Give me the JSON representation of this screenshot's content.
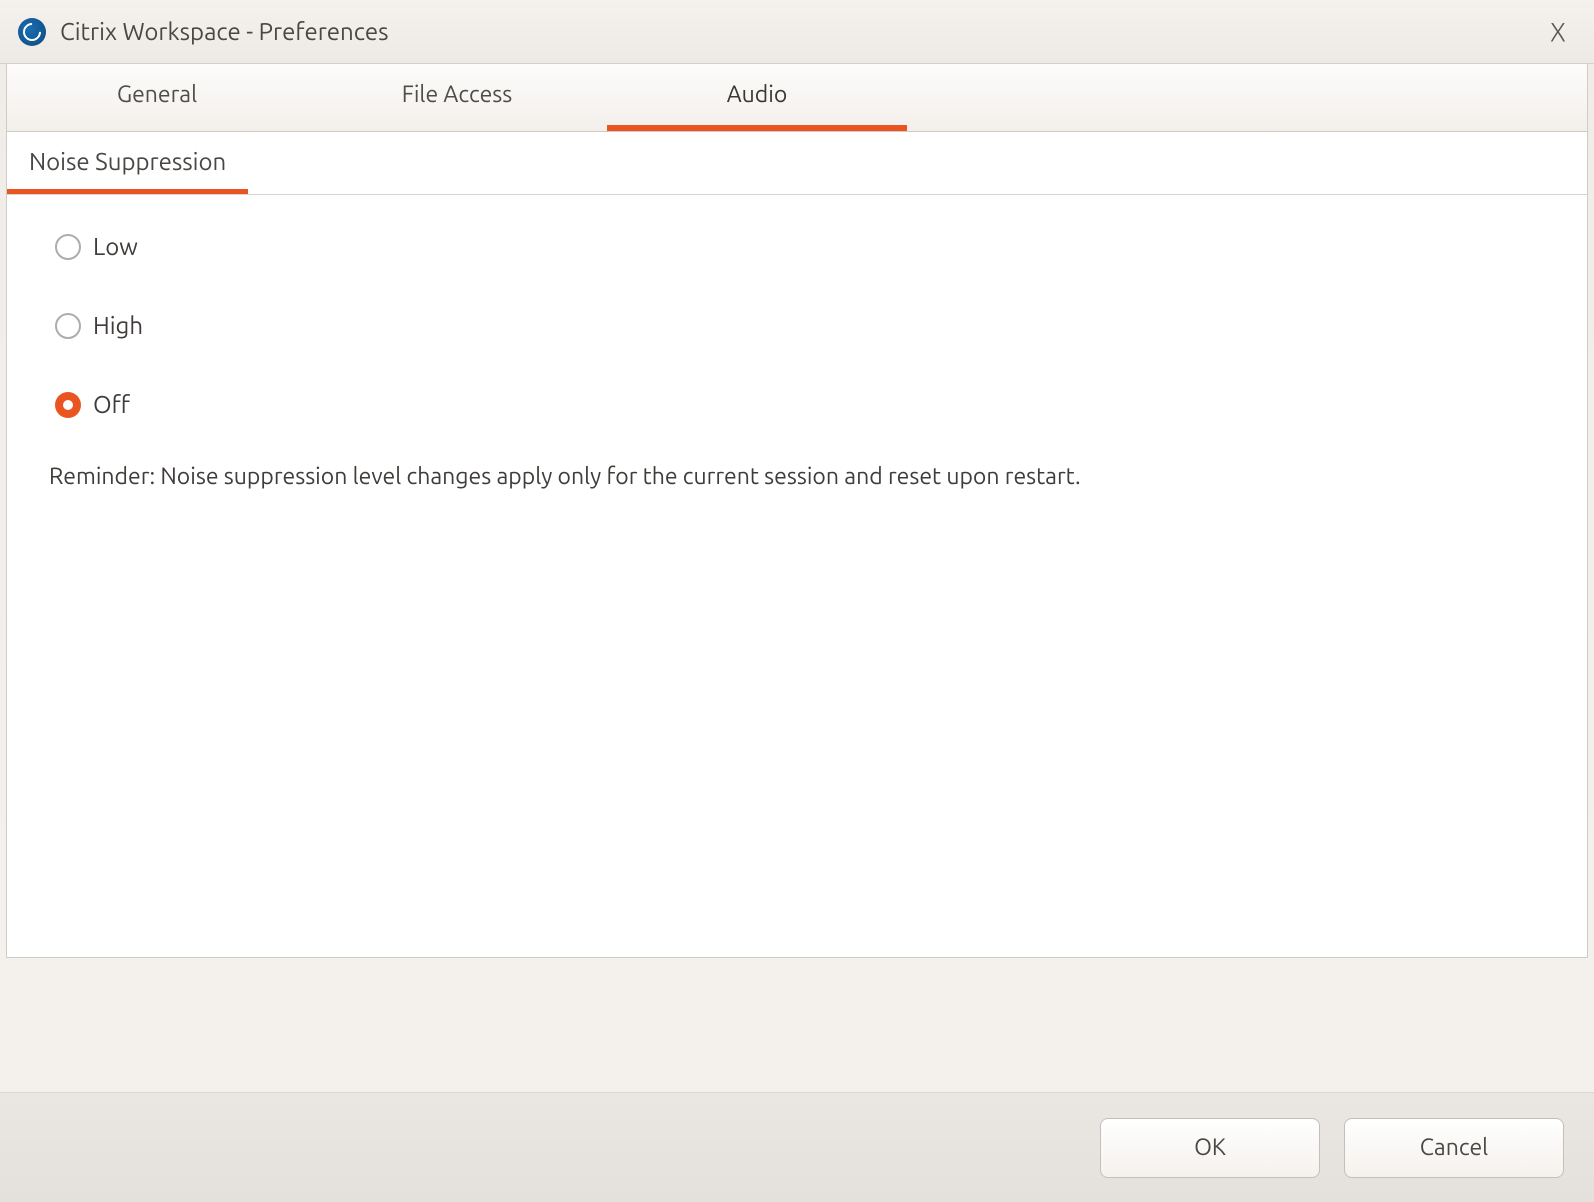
{
  "header": {
    "title": "Citrix Workspace - Preferences"
  },
  "tabs": {
    "general": "General",
    "file_access": "File Access",
    "audio": "Audio",
    "active": "audio"
  },
  "sub_tabs": {
    "noise_suppression": "Noise Suppression",
    "active": "noise_suppression"
  },
  "noise_suppression": {
    "options": {
      "low": "Low",
      "high": "High",
      "off": "Off"
    },
    "selected": "off",
    "reminder": "Reminder: Noise suppression level changes apply only for the current session and reset upon restart."
  },
  "footer": {
    "ok": "OK",
    "cancel": "Cancel"
  },
  "colors": {
    "accent": "#e95420"
  }
}
